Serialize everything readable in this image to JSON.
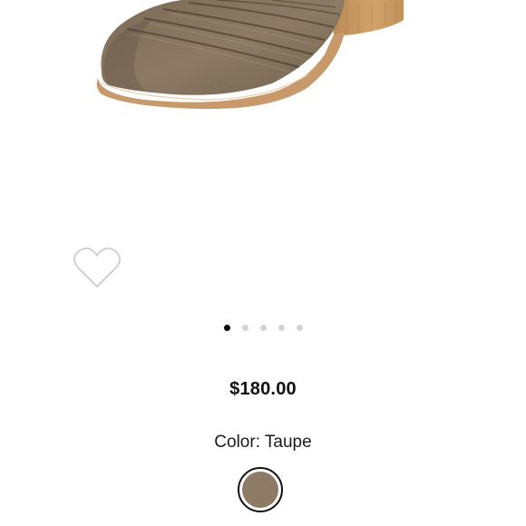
{
  "product": {
    "price": "$180.00",
    "color_label": "Color:",
    "color_value": "Taupe",
    "swatch_color": "#8d7b66"
  },
  "gallery": {
    "slide_count": 5,
    "active_index": 0
  },
  "colors": {
    "price_text": "#111111",
    "dot_active": "#000000",
    "dot_inactive": "#d3d3d3",
    "heart_outline": "#c8c8c8"
  },
  "icons": {
    "wishlist": "heart-outline-icon"
  }
}
